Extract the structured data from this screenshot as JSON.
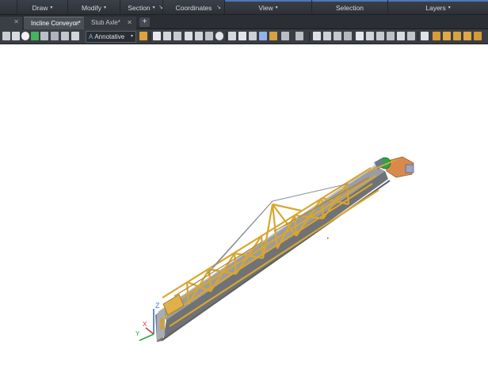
{
  "ribbon": {
    "panels": [
      {
        "label": "Draw",
        "arrow": "▾"
      },
      {
        "label": "Modify",
        "arrow": "▾"
      },
      {
        "label": "Section",
        "arrow": "▾"
      },
      {
        "label": "Coordinates",
        "arrow": ""
      },
      {
        "label": "View",
        "arrow": "▾"
      },
      {
        "label": "Selection",
        "arrow": ""
      },
      {
        "label": "Layers",
        "arrow": "▾"
      }
    ],
    "launcher_glyph": "↘"
  },
  "tabs": {
    "close_glyph": "✕",
    "items": [
      {
        "label": "Incline Conveyor*"
      },
      {
        "label": "Stub Axle*"
      }
    ],
    "add_glyph": "+"
  },
  "toolbar": {
    "annotation_scale": "Annotative",
    "annotation_glyph": "A",
    "dropdown_glyph": "▾"
  },
  "viewport": {
    "ucs_labels": {
      "z": "Z",
      "y": "Y",
      "x": "X"
    },
    "colors": {
      "truss": "#d9a62e",
      "truss_dark": "#b58220",
      "belt": "#8f9296",
      "belt_dark": "#6c6f73",
      "drive_orange": "#d98a4a",
      "motor_green": "#2fa24a",
      "tail_pulley": "#e0b04a",
      "ucs_z": "#3a6fd6",
      "ucs_x": "#d03a3a",
      "ucs_y": "#2fa24a"
    }
  }
}
